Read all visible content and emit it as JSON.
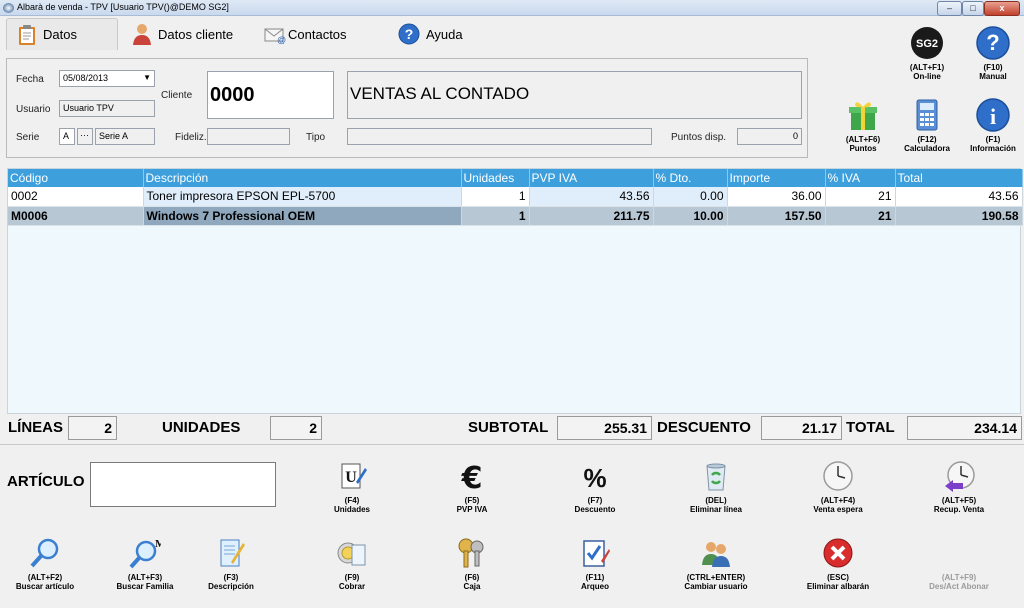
{
  "window": {
    "title": "Albarà de venda - TPV [Usuario TPV()@DEMO SG2]",
    "minimize": "–",
    "maximize": "□",
    "close": "x"
  },
  "tabs": [
    {
      "label": "Datos",
      "icon": "clipboard-icon"
    },
    {
      "label": "Datos cliente",
      "icon": "person-icon"
    },
    {
      "label": "Contactos",
      "icon": "mail-icon"
    },
    {
      "label": "Ayuda",
      "icon": "help-icon"
    }
  ],
  "form": {
    "fecha_label": "Fecha",
    "fecha_value": "05/08/2013",
    "usuario_label": "Usuario",
    "usuario_value": "Usuario TPV",
    "serie_label": "Serie",
    "serie_code": "A",
    "serie_dots": "···",
    "serie_name": "Serie A",
    "cliente_label": "Cliente",
    "cliente_code": "0000",
    "cliente_name": "VENTAS AL CONTADO",
    "fideliz_label": "Fideliz.",
    "tipo_label": "Tipo",
    "puntos_label": "Puntos disp.",
    "puntos_value": "0"
  },
  "right_toolbar": [
    {
      "key": "(ALT+F1)",
      "label": "On-line",
      "icon": "sg2-logo-icon"
    },
    {
      "key": "(F10)",
      "label": "Manual",
      "icon": "help-icon"
    },
    {
      "key": "(ALT+F6)",
      "label": "Puntos",
      "icon": "gift-icon"
    },
    {
      "key": "(F12)",
      "label": "Calculadora",
      "icon": "calculator-icon"
    },
    {
      "key": "(F1)",
      "label": "Información",
      "icon": "info-icon"
    }
  ],
  "grid": {
    "columns": [
      "Código",
      "Descripción",
      "Unidades",
      "PVP IVA",
      "% Dto.",
      "Importe",
      "% IVA",
      "Total"
    ],
    "rows": [
      [
        "0002",
        "Toner impresora EPSON EPL-5700",
        "1",
        "43.56",
        "0.00",
        "36.00",
        "21",
        "43.56"
      ],
      [
        "M0006",
        "Windows 7 Professional OEM",
        "1",
        "211.75",
        "10.00",
        "157.50",
        "21",
        "190.58"
      ]
    ]
  },
  "totals": {
    "lineas_label": "LÍNEAS",
    "lineas": "2",
    "unidades_label": "UNIDADES",
    "unidades": "2",
    "subtotal_label": "SUBTOTAL",
    "subtotal": "255.31",
    "descuento_label": "DESCUENTO",
    "descuento": "21.17",
    "total_label": "TOTAL",
    "total": "234.14"
  },
  "articulo_label": "ARTÍCULO",
  "articulo_value": "",
  "bottom_row1": [
    {
      "key": "(F4)",
      "label": "Unidades",
      "icon": "pencil-paper-icon"
    },
    {
      "key": "(F5)",
      "label": "PVP IVA",
      "icon": "euro-icon"
    },
    {
      "key": "(F7)",
      "label": "Descuento",
      "icon": "percent-icon"
    },
    {
      "key": "(DEL)",
      "label": "Eliminar línea",
      "icon": "recycle-bin-icon"
    },
    {
      "key": "(ALT+F4)",
      "label": "Venta espera",
      "icon": "clock-icon"
    },
    {
      "key": "(ALT+F5)",
      "label": "Recup. Venta",
      "icon": "clock-arrow-icon"
    }
  ],
  "bottom_row2": [
    {
      "key": "(ALT+F2)",
      "label": "Buscar artículo",
      "icon": "magnifier-icon"
    },
    {
      "key": "(ALT+F3)",
      "label": "Buscar Familia",
      "icon": "magnifier-m-icon"
    },
    {
      "key": "(F3)",
      "label": "Descripción",
      "icon": "notepad-icon"
    },
    {
      "key": "(F9)",
      "label": "Cobrar",
      "icon": "coins-icon"
    },
    {
      "key": "(F6)",
      "label": "Caja",
      "icon": "keys-icon"
    },
    {
      "key": "(F11)",
      "label": "Arqueo",
      "icon": "checklist-icon"
    },
    {
      "key": "(CTRL+ENTER)",
      "label": "Cambiar usuario",
      "icon": "users-icon"
    },
    {
      "key": "(ESC)",
      "label": "Eliminar albarán",
      "icon": "cancel-icon"
    },
    {
      "key": "(ALT+F9)",
      "label": "Des/Act Abonar",
      "icon": "none"
    }
  ]
}
